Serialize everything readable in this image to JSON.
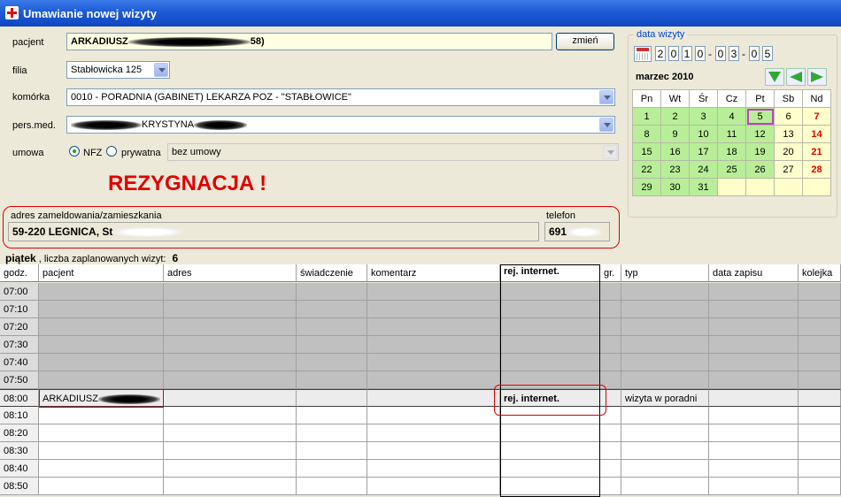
{
  "window": {
    "title": "Umawianie nowej wizyty"
  },
  "form": {
    "pacjent_label": "pacjent",
    "pacjent_value_start": "ARKADIUSZ",
    "pacjent_value_end": "58)",
    "zmien_label": "zmień",
    "filia_label": "filia",
    "filia_value": "Stabłowicka 125",
    "komorka_label": "komórka",
    "komorka_value": "0010 - PORADNIA (GABINET) LEKARZA POZ - \"STABŁOWICE\"",
    "persmed_label": "pers.med.",
    "persmed_value": "KRYSTYNA",
    "umowa_label": "umowa",
    "nfz_label": "NFZ",
    "prywatna_label": "prywatna",
    "umowa_value": "bez umowy",
    "rezygnacja": "REZYGNACJA !",
    "adres_label": "adres zameldowania/zamieszkania",
    "adres_value": "59-220 LEGNICA, St",
    "telefon_label": "telefon",
    "telefon_value": "691"
  },
  "date": {
    "legend": "data wizyty",
    "chars": [
      "2",
      "0",
      "1",
      "0",
      "0",
      "3",
      "0",
      "5"
    ],
    "month": "marzec  2010"
  },
  "calendar": {
    "headers": [
      "Pn",
      "Wt",
      "Śr",
      "Cz",
      "Pt",
      "Sb",
      "Nd"
    ],
    "rows": [
      [
        "1",
        "2",
        "3",
        "4",
        "5",
        "6",
        "7"
      ],
      [
        "8",
        "9",
        "10",
        "11",
        "12",
        "13",
        "14"
      ],
      [
        "15",
        "16",
        "17",
        "18",
        "19",
        "20",
        "21"
      ],
      [
        "22",
        "23",
        "24",
        "25",
        "26",
        "27",
        "28"
      ],
      [
        "29",
        "30",
        "31",
        "",
        "",
        "",
        ""
      ]
    ],
    "selected_day": "5"
  },
  "schedule": {
    "day": "piątek",
    "planned_label": ", liczba zaplanowanych wizyt:",
    "planned_count": "6",
    "columns": [
      "godz.",
      "pacjent",
      "adres",
      "świadczenie",
      "komentarz",
      "rej. internet.",
      "gr.",
      "typ",
      "data zapisu",
      "kolejka"
    ],
    "rows": [
      {
        "time": "07:00",
        "kind": "gray"
      },
      {
        "time": "07:10",
        "kind": "gray"
      },
      {
        "time": "07:20",
        "kind": "gray"
      },
      {
        "time": "07:30",
        "kind": "gray"
      },
      {
        "time": "07:40",
        "kind": "gray"
      },
      {
        "time": "07:50",
        "kind": "gray"
      },
      {
        "time": "08:00",
        "kind": "sel",
        "pacjent": "ARKADIUSZ",
        "rej": "rej. internet.",
        "typ": "wizyta w poradni"
      },
      {
        "time": "08:10",
        "kind": "white"
      },
      {
        "time": "08:20",
        "kind": "white"
      },
      {
        "time": "08:30",
        "kind": "white"
      },
      {
        "time": "08:40",
        "kind": "white"
      },
      {
        "time": "08:50",
        "kind": "white"
      }
    ]
  }
}
